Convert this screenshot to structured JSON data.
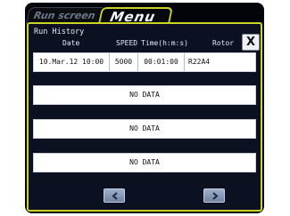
{
  "tabs": {
    "run_screen": "Run screen",
    "menu": "Menu"
  },
  "panel": {
    "title": "Run History",
    "close_label": "X"
  },
  "columns": {
    "date": "Date",
    "speed": "SPEED",
    "time": "Time(h:m:s)",
    "rotor": "Rotor"
  },
  "rows": [
    {
      "date": "10.Mar.12 10:00",
      "speed": "5000",
      "time": "00:01:00",
      "rotor": "R22A4"
    },
    {
      "no_data": "NO DATA"
    },
    {
      "no_data": "NO DATA"
    },
    {
      "no_data": "NO DATA"
    }
  ],
  "nav": {
    "prev_icon": "chevron-left-icon",
    "next_icon": "chevron-right-icon"
  },
  "colors": {
    "accent": "#c9d328",
    "background": "#0b1120"
  }
}
